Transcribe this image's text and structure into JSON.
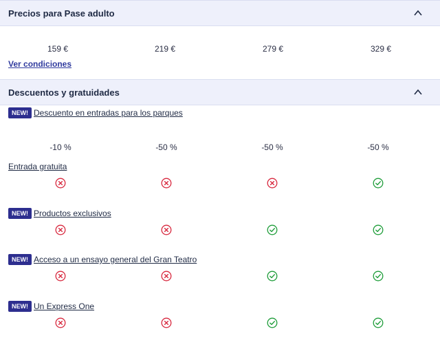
{
  "prices": {
    "title": "Precios para Pase adulto",
    "values": [
      "159 €",
      "219 €",
      "279 €",
      "329 €"
    ],
    "conditions_link": "Ver condiciones"
  },
  "discounts": {
    "title": "Descuentos y gratuidades",
    "rows": [
      {
        "new": true,
        "badge": "NEW!",
        "label": "Descuento en entradas para los parques",
        "values": [
          "-10 %",
          "-50 %",
          "-50 %",
          "-50 %"
        ]
      },
      {
        "new": false,
        "label": "Entrada gratuita",
        "status": [
          "no",
          "no",
          "no",
          "yes"
        ]
      },
      {
        "new": true,
        "badge": "NEW!",
        "label": "Productos exclusivos",
        "status": [
          "no",
          "no",
          "yes",
          "yes"
        ]
      },
      {
        "new": true,
        "badge": "NEW!",
        "label": "Acceso a un ensayo general del Gran Teatro",
        "status": [
          "no",
          "no",
          "yes",
          "yes"
        ]
      },
      {
        "new": true,
        "badge": "NEW!",
        "label": "Un Express One",
        "status": [
          "no",
          "no",
          "yes",
          "yes"
        ]
      }
    ]
  },
  "colors": {
    "no": "#d8293f",
    "yes": "#1f9d3a",
    "badge": "#2d2e8f",
    "header_bg": "#eef0fb"
  },
  "icons": {
    "no": "x-circle-icon",
    "yes": "check-circle-icon",
    "toggle": "chevron-up-icon"
  }
}
